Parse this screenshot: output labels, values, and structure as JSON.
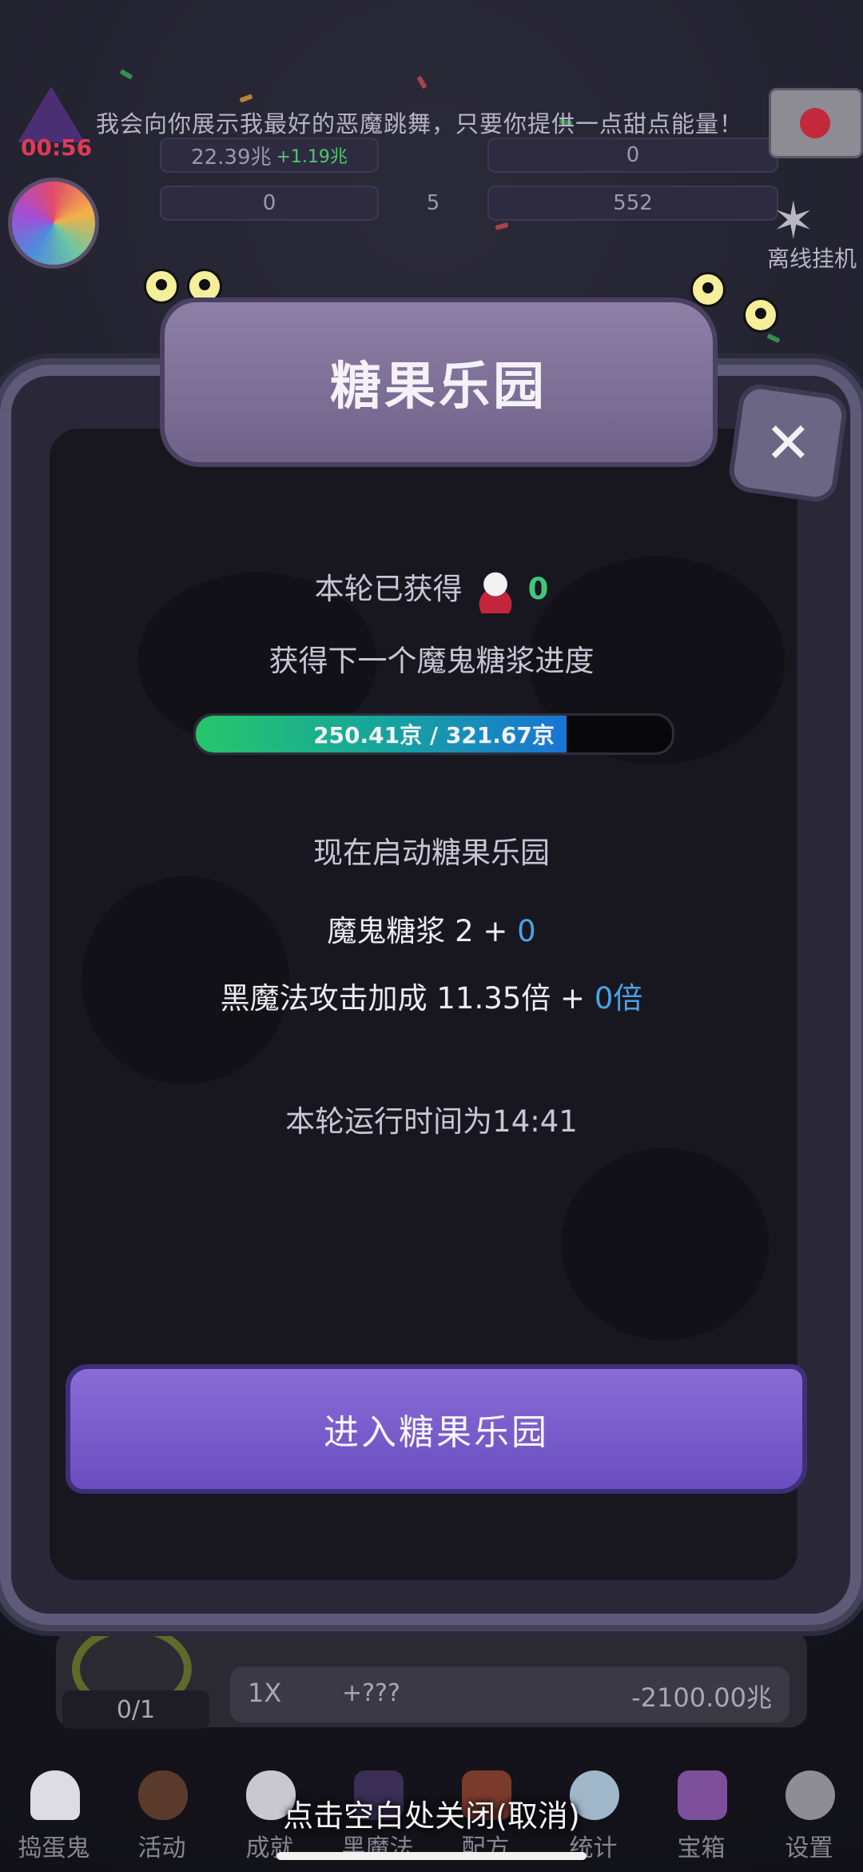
{
  "background": {
    "banner_text": "我会向你展示我最好的恶魔跳舞，只要你提供一点甜点能量！",
    "timer": "00:56",
    "stats": {
      "income": "22.39兆",
      "income_delta": "+1.19兆",
      "stat_top_right": "0",
      "stat_left": "0",
      "stat_mid": "5",
      "stat_right": "552"
    },
    "offline_label": "离线挂机",
    "upgrade_count": "0/1",
    "buy_multiplier": "1X",
    "buy_gain": "+???",
    "buy_cost": "-2100.00兆"
  },
  "modal": {
    "title": "糖果乐园",
    "earned_label": "本轮已获得",
    "earned_value": "0",
    "progress_title": "获得下一个魔鬼糖浆进度",
    "progress_text": "250.41京 / 321.67京",
    "progress_fraction": 0.778,
    "start_title": "现在启动糖果乐园",
    "syrup_label": "魔鬼糖浆 2 + ",
    "syrup_bonus": "0",
    "magic_label": "黑魔法攻击加成 11.35倍 + ",
    "magic_bonus": "0倍",
    "runtime_text": "本轮运行时间为14:41",
    "enter_button": "进入糖果乐园"
  },
  "nav": {
    "items": [
      {
        "label": "捣蛋鬼",
        "icon": "ghost-icon"
      },
      {
        "label": "活动",
        "icon": "cupcake-icon"
      },
      {
        "label": "成就",
        "icon": "skull-trophy-icon"
      },
      {
        "label": "黑魔法",
        "icon": "witch-hat-icon"
      },
      {
        "label": "配方",
        "icon": "book-icon"
      },
      {
        "label": "统计",
        "icon": "crystal-ball-icon"
      },
      {
        "label": "宝箱",
        "icon": "treasure-chest-icon"
      },
      {
        "label": "设置",
        "icon": "gear-icon"
      }
    ]
  },
  "dismiss_hint": "点击空白处关闭(取消)",
  "colors": {
    "progress_start": "#27c66b",
    "progress_end": "#1a74d6",
    "accent_blue": "#4aa3e6",
    "earned_green": "#3ec77a",
    "enter_button": "#7a5dcc"
  }
}
